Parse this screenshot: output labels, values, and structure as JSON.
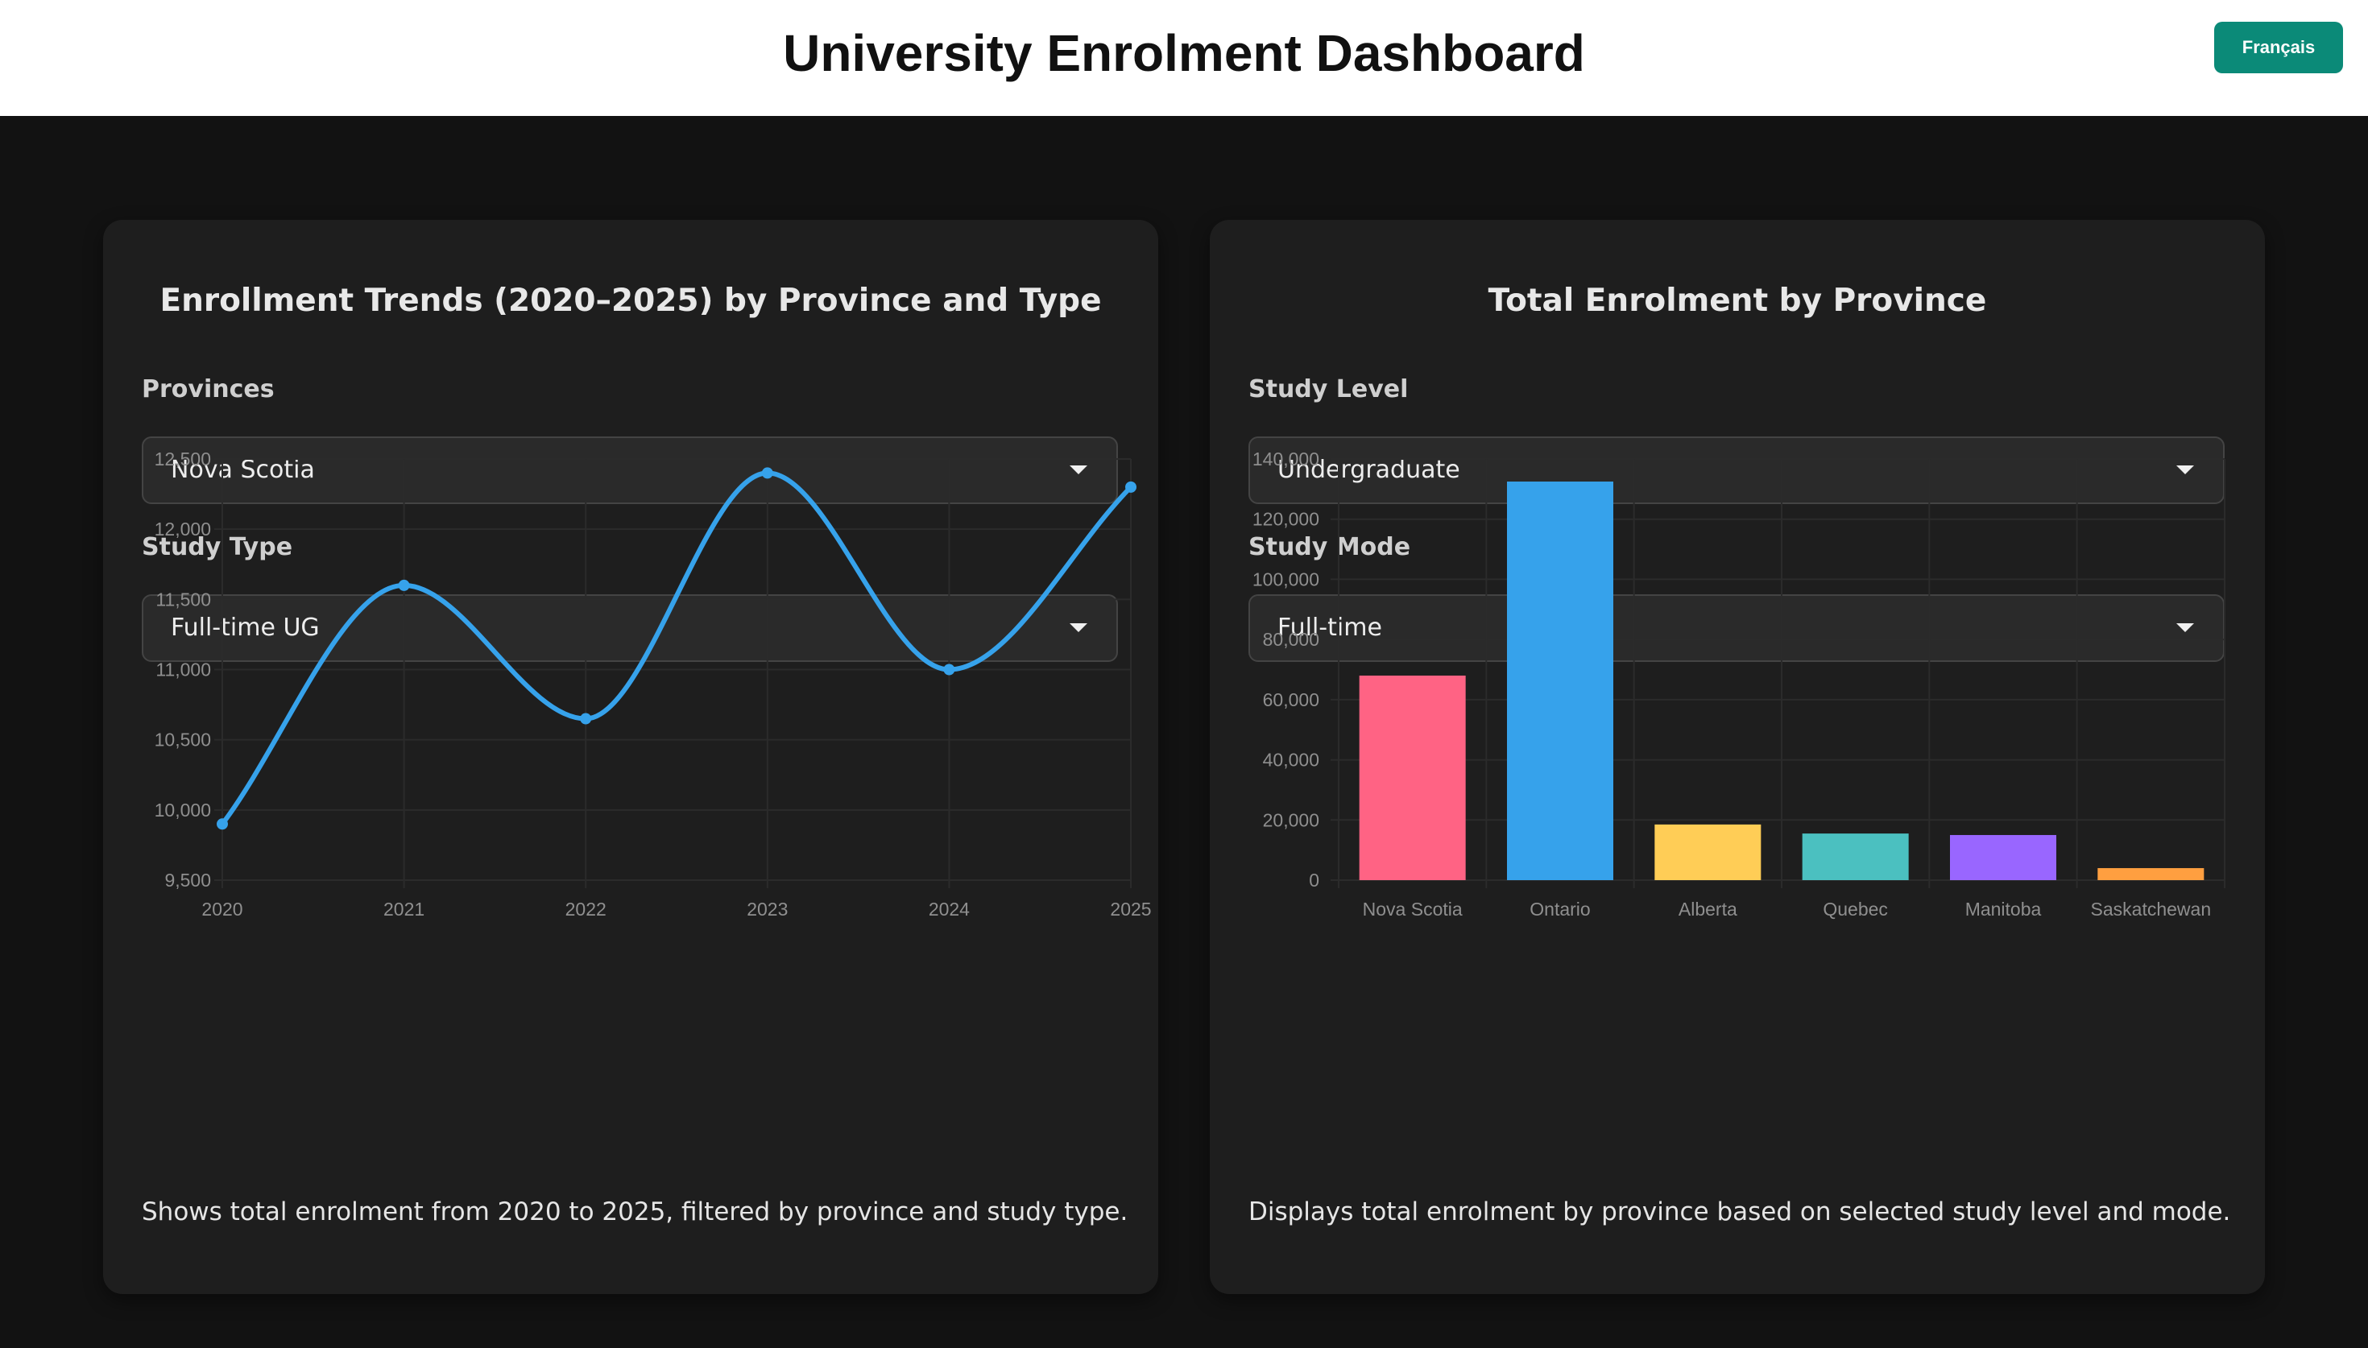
{
  "header": {
    "title": "University Enrolment Dashboard",
    "language_button": "Français"
  },
  "colors": {
    "accent": "#0b8a78",
    "background": "#121212",
    "card": "#1e1e1e"
  },
  "trend_card": {
    "title": "Enrollment Trends (2020–2025) by Province and Type",
    "province_label": "Provinces",
    "province_value": "Nova Scotia",
    "study_type_label": "Study Type",
    "study_type_value": "Full-time UG",
    "caption": "Shows total enrolment from 2020 to 2025, filtered by province and study type."
  },
  "province_card": {
    "title": "Total Enrolment by Province",
    "study_level_label": "Study Level",
    "study_level_value": "Undergraduate",
    "study_mode_label": "Study Mode",
    "study_mode_value": "Full-time",
    "caption": "Displays total enrolment by province based on selected study level and mode."
  },
  "chart_data": [
    {
      "type": "line",
      "x": [
        "2020",
        "2021",
        "2022",
        "2023",
        "2024",
        "2025"
      ],
      "series": [
        {
          "values": [
            9900,
            11600,
            10650,
            12400,
            11000,
            12300
          ],
          "color": "#36a2eb"
        }
      ],
      "ylim": [
        9500,
        12500
      ],
      "yticks": [
        "12,500",
        "12,000",
        "11,500",
        "11,000",
        "10,500",
        "10,000",
        "9,500"
      ],
      "grid": true,
      "smooth": true
    },
    {
      "type": "bar",
      "categories": [
        "Nova Scotia",
        "Ontario",
        "Alberta",
        "Quebec",
        "Manitoba",
        "Saskatchewan"
      ],
      "values": [
        68000,
        132500,
        18500,
        15500,
        15000,
        4000
      ],
      "colors": [
        "#ff6384",
        "#36a2eb",
        "#ffcd56",
        "#4bc0c0",
        "#9966ff",
        "#ff9f40"
      ],
      "ylim": [
        0,
        140000
      ],
      "yticks": [
        "140,000",
        "120,000",
        "100,000",
        "80,000",
        "60,000",
        "40,000",
        "20,000",
        "0"
      ],
      "grid": true
    }
  ]
}
